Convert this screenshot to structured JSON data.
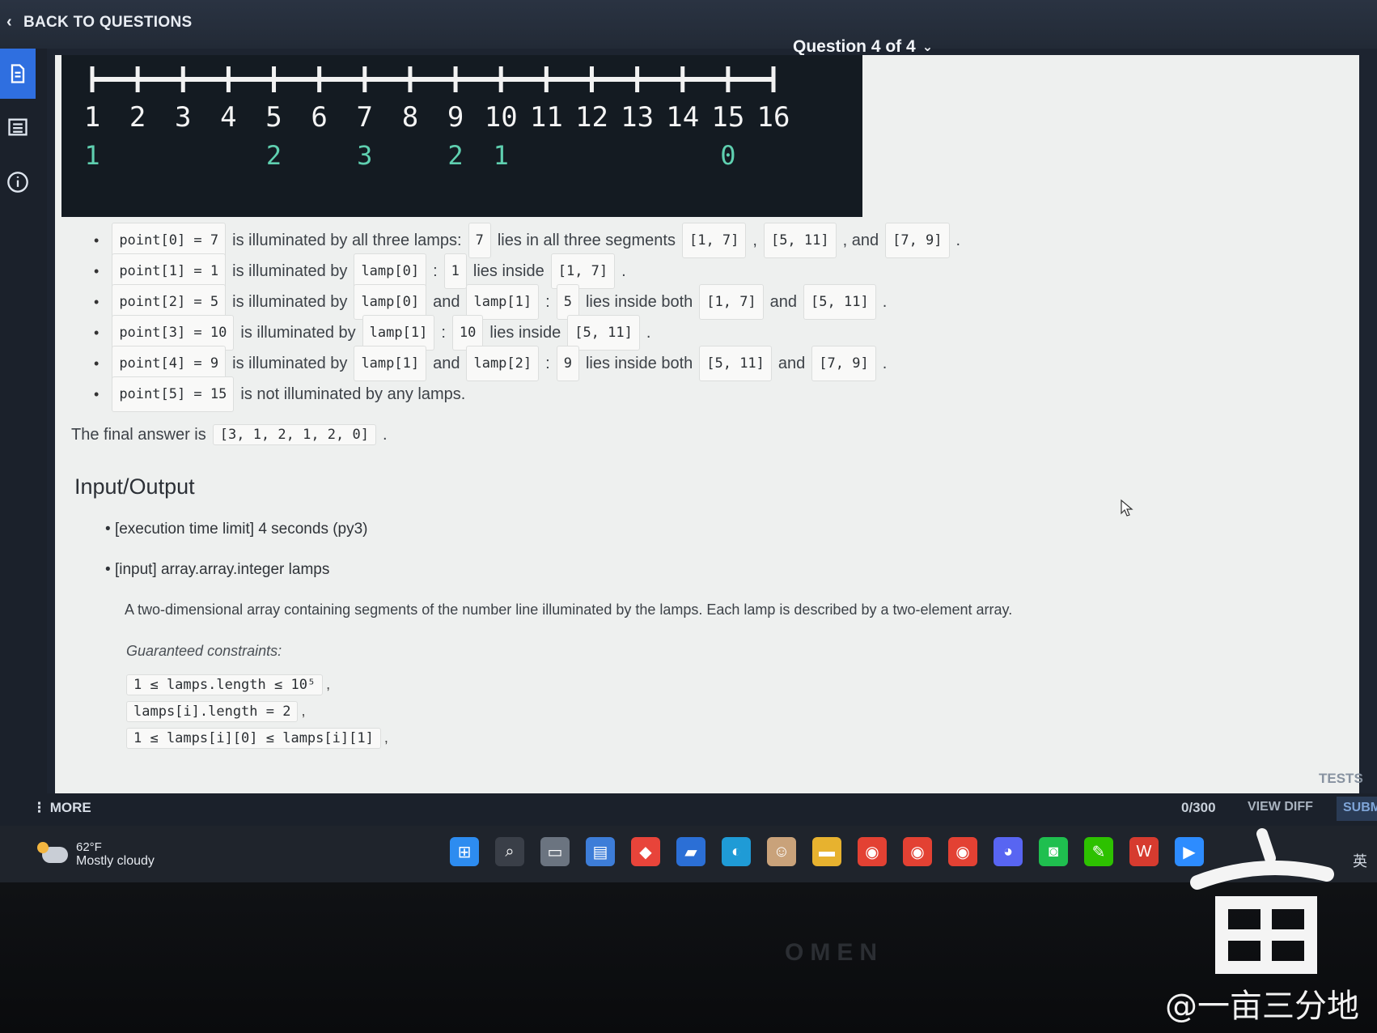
{
  "header": {
    "back_label": "BACK TO QUESTIONS",
    "question_nav": "Question 4 of 4"
  },
  "diagram": {
    "ticks": [
      "1",
      "2",
      "3",
      "4",
      "5",
      "6",
      "7",
      "8",
      "9",
      "10",
      "11",
      "12",
      "13",
      "14",
      "15",
      "16"
    ],
    "counts": [
      {
        "pos": "1",
        "value": "1"
      },
      {
        "pos": "5",
        "value": "2"
      },
      {
        "pos": "7",
        "value": "3"
      },
      {
        "pos": "9",
        "value": "2"
      },
      {
        "pos": "10",
        "value": "1"
      },
      {
        "pos": "15",
        "value": "0"
      }
    ]
  },
  "points": [
    {
      "code": "point[0] = 7",
      "parts": [
        "is illuminated by all three lamps:",
        "7",
        "lies in all three segments",
        "[1, 7]",
        ",",
        "[5, 11]",
        ", and",
        "[7, 9]",
        "."
      ]
    },
    {
      "code": "point[1] = 1",
      "parts": [
        "is illuminated by",
        "lamp[0]",
        ":",
        "1",
        "lies inside",
        "[1, 7]",
        "."
      ]
    },
    {
      "code": "point[2] = 5",
      "parts": [
        "is illuminated by",
        "lamp[0]",
        "and",
        "lamp[1]",
        ":",
        "5",
        "lies inside both",
        "[1, 7]",
        "and",
        "[5, 11]",
        "."
      ]
    },
    {
      "code": "point[3] = 10",
      "parts": [
        "is illuminated by",
        "lamp[1]",
        ":",
        "10",
        "lies inside",
        "[5, 11]",
        "."
      ]
    },
    {
      "code": "point[4] = 9",
      "parts": [
        "is illuminated by",
        "lamp[1]",
        "and",
        "lamp[2]",
        ":",
        "9",
        "lies inside both",
        "[5, 11]",
        "and",
        "[7, 9]",
        "."
      ]
    },
    {
      "code": "point[5] = 15",
      "parts": [
        "is not illuminated by any lamps."
      ]
    }
  ],
  "final": {
    "label": "The final answer is",
    "value": "[3, 1, 2, 1, 2, 0]",
    "end": "."
  },
  "io": {
    "title": "Input/Output",
    "time_limit": "[execution time limit] 4 seconds (py3)",
    "input_label": "[input] array.array.integer lamps",
    "description": "A two-dimensional array containing segments of the number line illuminated by the lamps. Each lamp is described by a two-element array.",
    "guaranteed": "Guaranteed constraints:",
    "constraints": [
      "1 ≤ lamps.length ≤ 10⁵",
      "lamps[i].length = 2",
      "1 ≤ lamps[i][0] ≤ lamps[i][1]"
    ],
    "constraint_suffix": ","
  },
  "footer": {
    "more": "MORE",
    "counter": "0/300",
    "view_diff": "VIEW DIFF",
    "submit": "SUBM",
    "tests": "TESTS"
  },
  "taskbar": {
    "temp": "62°F",
    "condition": "Mostly cloudy",
    "ime": "英",
    "icons": [
      "windows-start-icon",
      "search-icon",
      "task-view-icon",
      "store-icon",
      "app-icon",
      "app-icon",
      "edge-icon",
      "photo-icon",
      "folder-icon",
      "chrome-icon",
      "chrome-icon",
      "chrome-icon",
      "discord-icon",
      "line-icon",
      "wechat-icon",
      "wps-icon",
      "zoom-icon"
    ]
  },
  "brand": "OMEN",
  "watermark": "@一亩三分地",
  "colors": {
    "accent": "#2f6fe0",
    "count_text": "#5fd0b0"
  }
}
